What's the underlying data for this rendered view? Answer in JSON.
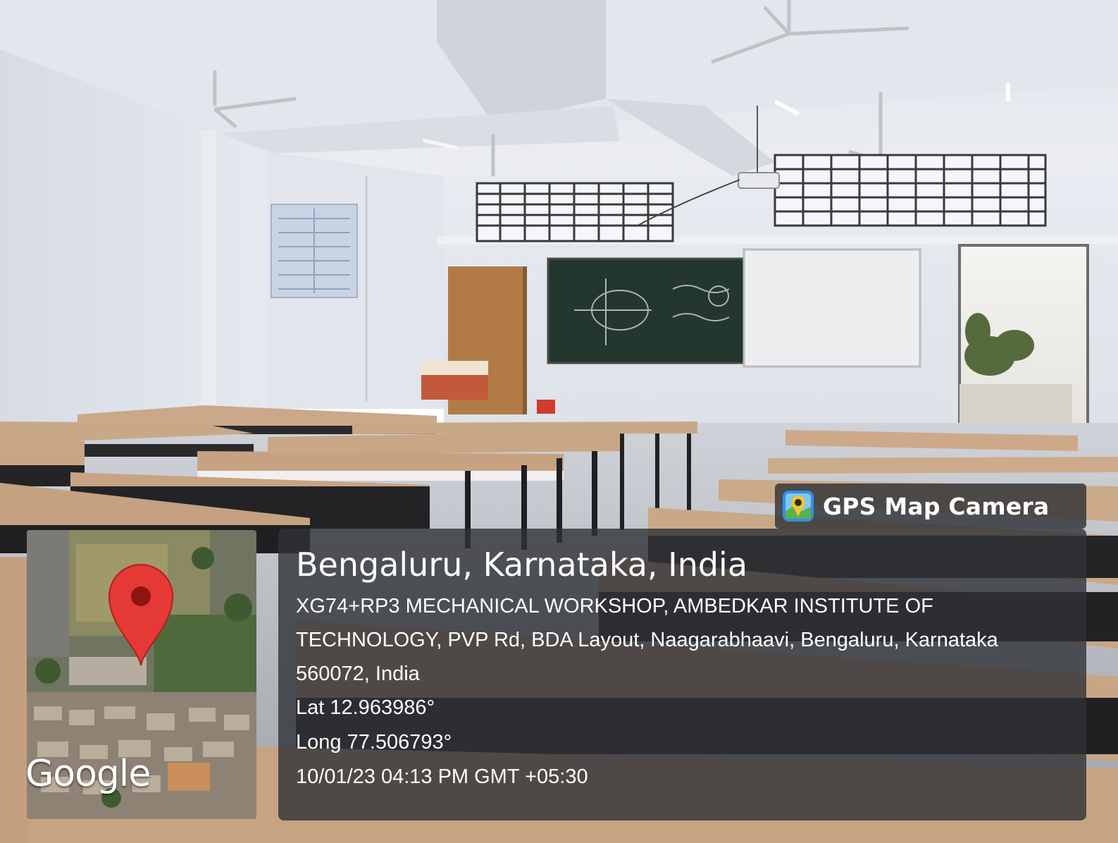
{
  "app": {
    "name": "GPS Map Camera",
    "icon": "gps-map-camera-icon"
  },
  "location": {
    "title": "Bengaluru, Karnataka, India",
    "address": "XG74+RP3 MECHANICAL WORKSHOP, AMBEDKAR INSTITUTE OF TECHNOLOGY, PVP Rd, BDA Layout, Naagarabhaavi, Bengaluru, Karnataka 560072, India",
    "latitude": "Lat 12.963986°",
    "longitude": "Long 77.506793°",
    "timestamp": "10/01/23 04:13 PM GMT +05:30"
  },
  "map": {
    "provider": "Google",
    "pin_color": "#e53935",
    "pin_icon": "map-pin-icon"
  },
  "colors": {
    "overlay": "#303237",
    "text": "#ffffff"
  }
}
